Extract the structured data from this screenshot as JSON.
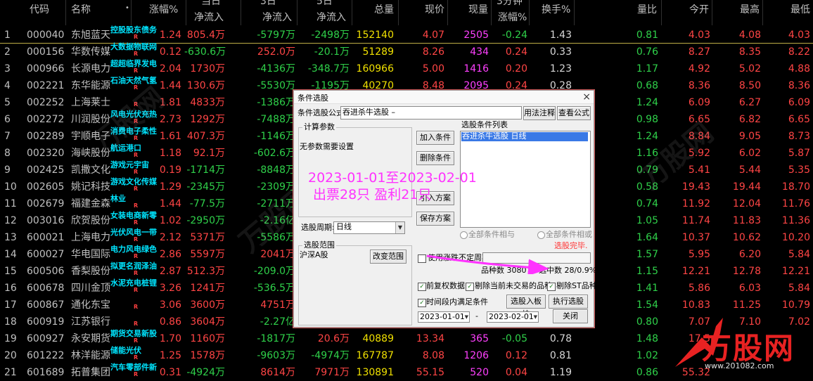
{
  "header": {
    "columns": [
      {
        "top": "",
        "bottom": "",
        "label": "代码"
      },
      {
        "label": "名称"
      },
      {
        "label": "涨幅%"
      },
      {
        "top": "当日",
        "bottom": "净流入"
      },
      {
        "top": "3日",
        "bottom": "净流入"
      },
      {
        "top": "5日",
        "bottom": "净流入"
      },
      {
        "label": "总量"
      },
      {
        "label": "现价"
      },
      {
        "label": "现量"
      },
      {
        "top": "3分钟",
        "bottom": "涨幅%"
      },
      {
        "label": "换手%"
      },
      {
        "label": "量比"
      },
      {
        "label": "今开"
      },
      {
        "label": "最高"
      },
      {
        "label": "最低"
      }
    ],
    "name_marker": "•"
  },
  "rows": [
    {
      "i": "1",
      "code": "000040",
      "name": "东旭蓝天",
      "tag": "控股股东债务",
      "r": "R",
      "chg": "1.24",
      "f1": "805.4万",
      "f2": "-5797万",
      "f3": "-2498万",
      "vol": "152140",
      "price": "4.07",
      "now": "2505",
      "m5": "-0.24",
      "turn": "1.43",
      "ratio": "0.81",
      "open": "4.03",
      "high": "4.08",
      "low": "4.03"
    },
    {
      "i": "2",
      "code": "000156",
      "name": "华数传媒",
      "tag": "大数据物联网",
      "r": "R",
      "chg": "0.12",
      "f1": "-630.6万",
      "f2": "252.0万",
      "f3": "-20.1万",
      "vol": "51289",
      "price": "8.26",
      "now": "434",
      "m5": "0.24",
      "turn": "0.33",
      "ratio": "0.76",
      "open": "8.27",
      "high": "8.35",
      "low": "8.22"
    },
    {
      "i": "3",
      "code": "000966",
      "name": "长源电力",
      "tag": "超超临界发电",
      "r": "R",
      "chg": "2.04",
      "f1": "1730万",
      "f2": "-4136万",
      "f3": "-348.7万",
      "vol": "160966",
      "price": "5.00",
      "now": "1416",
      "m5": "0.20",
      "turn": "1.23",
      "ratio": "1.17",
      "open": "4.92",
      "high": "5.02",
      "low": "4.88"
    },
    {
      "i": "4",
      "code": "002221",
      "name": "东华能源",
      "tag": "石油天然气氢",
      "r": "R",
      "chg": "1.44",
      "f1": "130.6万",
      "f2": "-5530万",
      "f3": "-1195万",
      "vol": "40270",
      "price": "8.48",
      "now": "2095",
      "m5": "0.24",
      "turn": "0.28",
      "ratio": "0.68",
      "open": "8.36",
      "high": "8.50",
      "low": "8.36"
    },
    {
      "i": "5",
      "code": "002252",
      "name": "上海莱士",
      "tag": "",
      "r": "R",
      "chg": "1.81",
      "f1": "4833万",
      "f2": "-1386万",
      "f3": "",
      "vol": "",
      "price": "",
      "now": "",
      "m5": "",
      "turn": "",
      "ratio": "1.24",
      "open": "6.09",
      "high": "6.27",
      "low": "6.09"
    },
    {
      "i": "6",
      "code": "002272",
      "name": "川润股份",
      "tag": "风电光伏充热",
      "r": "R",
      "chg": "2.73",
      "f1": "1292万",
      "f2": "-7488万",
      "f3": "",
      "vol": "",
      "price": "",
      "now": "",
      "m5": "",
      "turn": "",
      "ratio": "0.98",
      "open": "6.65",
      "high": "6.82",
      "low": "6.65"
    },
    {
      "i": "7",
      "code": "002289",
      "name": "宇顺电子",
      "tag": "消费电子柔性",
      "r": "R",
      "chg": "1.61",
      "f1": "407.3万",
      "f2": "-1146万",
      "f3": "",
      "vol": "",
      "price": "",
      "now": "",
      "m5": "",
      "turn": "",
      "ratio": "1.24",
      "open": "8.84",
      "high": "9.05",
      "low": "8.73"
    },
    {
      "i": "8",
      "code": "002320",
      "name": "海峡股份",
      "tag": "航运港口",
      "r": "R",
      "chg": "1.18",
      "f1": "92.1万",
      "f2": "-602.6万",
      "f3": "",
      "vol": "",
      "price": "",
      "now": "",
      "m5": "",
      "turn": "",
      "ratio": "1.16",
      "open": "5.92",
      "high": "6.02",
      "low": "5.87"
    },
    {
      "i": "9",
      "code": "002425",
      "name": "凯撒文化",
      "tag": "游戏元宇宙",
      "r": "R",
      "chg": "0.19",
      "f1": "-1714万",
      "f2": "-8848万",
      "f3": "",
      "vol": "",
      "price": "",
      "now": "",
      "m5": "",
      "turn": "",
      "ratio": "0.79",
      "open": "5.41",
      "high": "5.44",
      "low": "5.35"
    },
    {
      "i": "10",
      "code": "002605",
      "name": "姚记科技",
      "tag": "游戏文化传媒",
      "r": "R",
      "chg": "1.29",
      "f1": "-2345万",
      "f2": "-2309万",
      "f3": "",
      "vol": "",
      "price": "",
      "now": "",
      "m5": "",
      "turn": "",
      "ratio": "0.58",
      "open": "19.43",
      "high": "19.44",
      "low": "18.70"
    },
    {
      "i": "11",
      "code": "002679",
      "name": "福建金森",
      "tag": "林业",
      "r": "R",
      "chg": "1.44",
      "f1": "-77.5万",
      "f2": "-2711万",
      "f3": "",
      "vol": "",
      "price": "",
      "now": "",
      "m5": "",
      "turn": "",
      "ratio": "0.74",
      "open": "11.92",
      "high": "12.04",
      "low": "11.76"
    },
    {
      "i": "12",
      "code": "003016",
      "name": "欣贺股份",
      "tag": "女装电商新零",
      "r": "R",
      "chg": "1.02",
      "f1": "-2950万",
      "f2": "-2.16亿",
      "f3": "",
      "vol": "",
      "price": "",
      "now": "",
      "m5": "",
      "turn": "",
      "ratio": "1.05",
      "open": "11.74",
      "high": "11.83",
      "low": "11.36"
    },
    {
      "i": "13",
      "code": "600021",
      "name": "上海电力",
      "tag": "光伏风电一带",
      "r": "R",
      "chg": "2.12",
      "f1": "5371万",
      "f2": "-5586万",
      "f3": "",
      "vol": "",
      "price": "",
      "now": "",
      "m5": "",
      "turn": "",
      "ratio": "1.64",
      "open": "10.37",
      "high": "10.62",
      "low": "10.20"
    },
    {
      "i": "14",
      "code": "600027",
      "name": "华电国际",
      "tag": "电力风电绿色",
      "r": "R",
      "chg": "2.86",
      "f1": "5597万",
      "f2": "2041万",
      "f3": "",
      "vol": "",
      "price": "",
      "now": "",
      "m5": "",
      "turn": "",
      "ratio": "1.57",
      "open": "5.95",
      "high": "6.20",
      "low": "5.84"
    },
    {
      "i": "15",
      "code": "600506",
      "name": "香梨股份",
      "tag": "拟更名润泽油",
      "r": "R",
      "chg": "2.87",
      "f1": "512.3万",
      "f2": "-209.0万",
      "f3": "",
      "vol": "",
      "price": "",
      "now": "",
      "m5": "",
      "turn": "",
      "ratio": "1.15",
      "open": "12.21",
      "high": "12.78",
      "low": "12.21"
    },
    {
      "i": "16",
      "code": "600678",
      "name": "四川金顶",
      "tag": "水泥充电桩锂",
      "r": "R",
      "chg": "3.26",
      "f1": "1241万",
      "f2": "-536.5万",
      "f3": "",
      "vol": "",
      "price": "",
      "now": "",
      "m5": "",
      "turn": "",
      "ratio": "1.41",
      "open": "5.86",
      "high": "6.03",
      "low": "5.84"
    },
    {
      "i": "17",
      "code": "600867",
      "name": "通化东宝",
      "tag": "",
      "r": "R",
      "chg": "3.06",
      "f1": "3600万",
      "f2": "4751万",
      "f3": "",
      "vol": "",
      "price": "",
      "now": "",
      "m5": "",
      "turn": "",
      "ratio": "1.54",
      "open": "10.83",
      "high": "11.25",
      "low": "10.79"
    },
    {
      "i": "18",
      "code": "600919",
      "name": "江苏银行",
      "tag": "",
      "r": "R",
      "chg": "0.86",
      "f1": "3604万",
      "f2": "-2.27亿",
      "f3": "",
      "vol": "",
      "price": "",
      "now": "",
      "m5": "",
      "turn": "",
      "ratio": "0.80",
      "open": "7.07",
      "high": "7.10",
      "low": "7.02"
    },
    {
      "i": "19",
      "code": "600927",
      "name": "永安期货",
      "tag": "期货交易新股",
      "r": "R",
      "chg": "1.70",
      "f1": "1160万",
      "f2": "-1817万",
      "f3": "20.6万",
      "vol": "40889",
      "price": "13.34",
      "now": "365",
      "m5": "-0.05",
      "turn": "0.78",
      "ratio": "1.48",
      "open": "17.5",
      "high": "",
      "low": ""
    },
    {
      "i": "20",
      "code": "601222",
      "name": "林洋能源",
      "tag": "储能光伏",
      "r": "R",
      "chg": "1.25",
      "f1": "1578万",
      "f2": "-9603万",
      "f3": "-4974万",
      "vol": "167787",
      "price": "8.08",
      "now": "1206",
      "m5": "0.12",
      "turn": "0.81",
      "ratio": "1.02",
      "open": "",
      "high": "",
      "low": ""
    },
    {
      "i": "21",
      "code": "601689",
      "name": "拓普集团",
      "tag": "汽车零部件新",
      "r": "R",
      "chg": "0.31",
      "f1": "-4924万",
      "f2": "8614万",
      "f3": "7971万",
      "vol": "130891",
      "price": "55.15",
      "now": "520",
      "m5": "0.04",
      "turn": "1.19",
      "ratio": "0.86",
      "open": "55.32",
      "high": "",
      "low": ""
    }
  ],
  "dialog": {
    "title": "条件选股",
    "close_glyph": "×",
    "formula_label": "条件选股公式",
    "formula_value": "吞进杀牛选股 –",
    "usage_button": "用法注释",
    "view_formula_button": "查看公式",
    "params_group": "计算参数",
    "params_text": "无参数需要设置",
    "add_condition": "加入条件",
    "delete_condition": "删除条件",
    "import_plan": "引入方案",
    "save_plan": "保存方案",
    "list_label": "选股条件列表",
    "list_item": "吞进杀牛选股   日线",
    "period_label": "选股周期:",
    "period_value": "日线",
    "radio_and": "全部条件相与",
    "radio_or": "全部条件相或",
    "finish_text": "选股完毕.",
    "range_group": "选股范围",
    "range_value": "沪深A股",
    "change_range": "改变范围",
    "custom_period": "使用涨跌不定周期",
    "total_count": "品种数 3080",
    "selected_count": "选中数 28/0.9%",
    "opt_fq": "前复权数据",
    "opt_exclude_notrade": "剔除当前未交易的品种",
    "opt_exclude_st": "剔除ST品种",
    "opt_time": "时间段内满足条件",
    "add_to_block": "选股入板块",
    "run": "执行选股",
    "date_start": "2023-01-01",
    "date_end": "2023-02-01",
    "date_sep": "-",
    "close_button": "关闭"
  },
  "annotation": {
    "line1": "2023-01-01至2023-02-01",
    "line2": "出票28只 盈利21只"
  },
  "logo": {
    "text": "万股网",
    "url": "www.201082.com"
  },
  "colors": {
    "up": "#ff4545",
    "down": "#2fd14a",
    "volume": "#f0e000",
    "tag": "#00e5ff",
    "annotation": "#ff33ff"
  }
}
